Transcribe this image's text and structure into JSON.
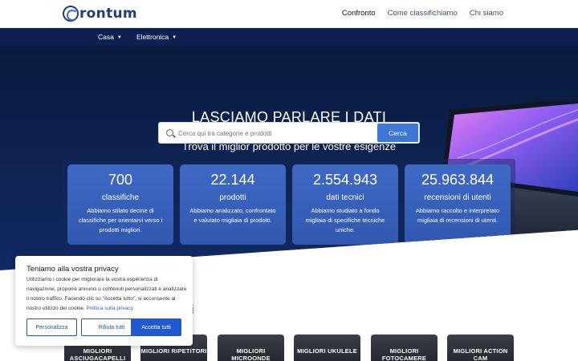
{
  "header": {
    "logo_text": "rontum",
    "nav": [
      "Confronto",
      "Come classifichiamo",
      "Chi siamo"
    ]
  },
  "categories": [
    "Casa",
    "Elettronica"
  ],
  "hero": {
    "title": "LASCIAMO PARLARE I DATI",
    "subtitle": "Trova il miglior prodotto per le vostre esigenze"
  },
  "search": {
    "placeholder": "Cerca qui tra categorie e prodotti",
    "button_label": "Cerca"
  },
  "stats": [
    {
      "number": "700",
      "label": "classifiche",
      "desc": "Abbiamo stilato decine di classifiche per orientarvi verso i prodotti migliori."
    },
    {
      "number": "22.144",
      "label": "prodotti",
      "desc": "Abbiamo analizzato, confrontato e valutato migliaia di prodotti."
    },
    {
      "number": "2.554.943",
      "label": "dati tecnici",
      "desc": "Abbiamo studiato a fondo migliaia di specifiche tecniche uniche."
    },
    {
      "number": "25.963.844",
      "label": "recensioni di utenti",
      "desc": "Abbiamo raccolto e interpretato migliaia di recensioni di utenti."
    }
  ],
  "section": {
    "heading_visible": "i"
  },
  "cards": [
    {
      "label": "MIGLIORI ASCIUGACAPELLI"
    },
    {
      "label": "MIGLIORI RIPETITORI"
    },
    {
      "label": "MIGLIORI MICROONDE"
    },
    {
      "label": "MIGLIORI UKULELE"
    },
    {
      "label": "MIGLIORI FOTOCAMERE"
    },
    {
      "label": "MIGLIORI ACTION CAM"
    }
  ],
  "cookie": {
    "title": "Teniamo alla vostra privacy",
    "text": "Utilizziamo i cookie per migliorare la vostra esperienza di navigazione, proporre annunci o contenuti personalizzati e analizzare il nostro traffico. Facendo clic su \"Accetta tutto\", si acconsente al nostro utilizzo dei cookie.",
    "link": "Politica sulla privacy",
    "buttons": {
      "customize": "Personalizza",
      "reject": "Rifiuta tutti",
      "accept": "Accetta tutti"
    }
  },
  "colors": {
    "brand": "#1e3d7a",
    "hero_bg": "#0e2352",
    "accent": "#3f78d4",
    "stat_card": "#3a63bf"
  }
}
